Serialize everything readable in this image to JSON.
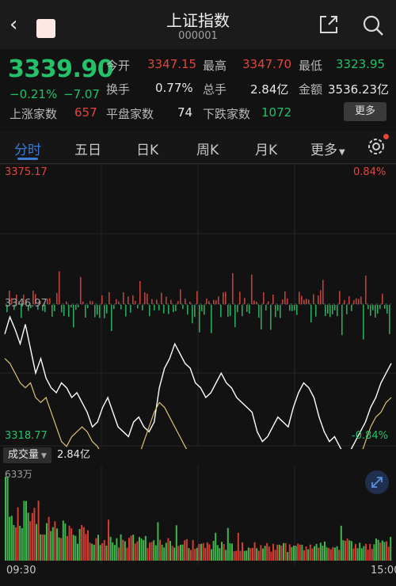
{
  "header": {
    "title": "上证指数",
    "code": "000001"
  },
  "quote": {
    "price": "3339.90",
    "change_pct": "−0.21%",
    "change": "−7.07",
    "stats": [
      {
        "label": "今开",
        "value": "3347.15",
        "tone": "red"
      },
      {
        "label": "最高",
        "value": "3347.70",
        "tone": "red"
      },
      {
        "label": "最低",
        "value": "3323.95",
        "tone": "green"
      },
      {
        "label": "换手",
        "value": "0.77%",
        "tone": "white"
      },
      {
        "label": "总手",
        "value": "2.84亿",
        "tone": "white"
      },
      {
        "label": "金额",
        "value": "3536.23亿",
        "tone": "white"
      }
    ],
    "breadth": [
      {
        "label": "上涨家数",
        "value": "657",
        "tone": "red"
      },
      {
        "label": "平盘家数",
        "value": "74",
        "tone": "white"
      },
      {
        "label": "下跌家数",
        "value": "1072",
        "tone": "green"
      }
    ],
    "more_label": "更多"
  },
  "tabs": {
    "items": [
      "分时",
      "五日",
      "日K",
      "周K",
      "月K",
      "更多"
    ],
    "active": "分时"
  },
  "chart": {
    "y_max": "3375.17",
    "y_mid": "3346.97",
    "y_min": "3318.77",
    "pct_max": "0.84%",
    "pct_min": "-0.84%"
  },
  "volume": {
    "label": "成交量",
    "total": "2.84亿",
    "max_label": "633万"
  },
  "time_axis": {
    "start": "09:30",
    "end": "15:00"
  },
  "chart_data": {
    "type": "line",
    "title": "",
    "ylim": [
      3318.77,
      3375.17
    ],
    "reference": 3346.97,
    "series": [
      {
        "name": "",
        "color": "#ffffff",
        "values": [
          3341,
          3344.5,
          3342,
          3339,
          3343,
          3338,
          3333,
          3336,
          3332,
          3330,
          3329,
          3331,
          3330,
          3328,
          3329,
          3327,
          3325,
          3322,
          3323,
          3326,
          3328,
          3325,
          3322,
          3321,
          3320,
          3323,
          3324,
          3322,
          3321,
          3323,
          3330,
          3334,
          3336,
          3339,
          3337,
          3335,
          3334,
          3331,
          3330,
          3328,
          3329,
          3331,
          3333,
          3331,
          3330,
          3328,
          3327,
          3326,
          3325,
          3321,
          3319,
          3320,
          3322,
          3324,
          3323,
          3322,
          3326,
          3329,
          3331,
          3330,
          3328,
          3324,
          3321,
          3319,
          3320,
          3318,
          3316,
          3317,
          3319,
          3321,
          3323,
          3326,
          3328,
          3331,
          3333,
          3335
        ]
      },
      {
        "name": "",
        "color": "#d9c277",
        "values": [
          3336,
          3335,
          3333,
          3331,
          3330,
          3331,
          3328,
          3327,
          3328,
          3325,
          3322,
          3319,
          3318,
          3320,
          3321,
          3322,
          3321,
          3319,
          3318,
          3316,
          3314,
          3312,
          3310,
          3311,
          3313,
          3314,
          3316,
          3319,
          3322,
          3325,
          3327,
          3326,
          3324,
          3322,
          3320,
          3318,
          3316,
          3314,
          3313,
          3312,
          3312,
          3313,
          3313,
          3311,
          3309,
          3306,
          3305,
          3307,
          3311,
          3313,
          3315,
          3314,
          3312,
          3309,
          3308,
          3311,
          3313,
          3315,
          3313,
          3311,
          3306,
          3303,
          3305,
          3302,
          3304,
          3306,
          3308,
          3310,
          3313,
          3316,
          3319,
          3322,
          3324,
          3325,
          3327,
          3328
        ]
      }
    ],
    "x_ticks": [
      "09:30",
      "15:00"
    ]
  }
}
